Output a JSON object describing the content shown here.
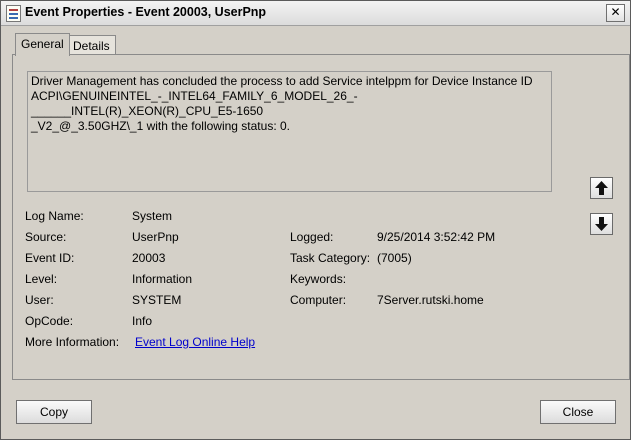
{
  "window": {
    "title": "Event Properties - Event 20003, UserPnp",
    "close_glyph": "✕"
  },
  "tabs": [
    {
      "label": "General"
    },
    {
      "label": "Details"
    }
  ],
  "description": "Driver Management has concluded the process to add Service intelppm for Device Instance ID\nACPI\\GENUINEINTEL_-_INTEL64_FAMILY_6_MODEL_26_-______INTEL(R)_XEON(R)_CPU_E5-1650\n_V2_@_3.50GHZ\\_1 with the following status: 0.",
  "fields": {
    "log_name": {
      "label": "Log Name:",
      "value": "System"
    },
    "source": {
      "label": "Source:",
      "value": "UserPnp"
    },
    "event_id": {
      "label": "Event ID:",
      "value": "20003"
    },
    "level": {
      "label": "Level:",
      "value": "Information"
    },
    "user": {
      "label": "User:",
      "value": "SYSTEM"
    },
    "opcode": {
      "label": "OpCode:",
      "value": "Info"
    },
    "more_info": {
      "label": "More Information:",
      "value": "Event Log Online Help"
    },
    "logged": {
      "label": "Logged:",
      "value": "9/25/2014 3:52:42 PM"
    },
    "task_category": {
      "label": "Task Category:",
      "value": "(7005)"
    },
    "keywords": {
      "label": "Keywords:",
      "value": ""
    },
    "computer": {
      "label": "Computer:",
      "value": "7Server.rutski.home"
    }
  },
  "nav": {
    "up_icon": "arrow-up-icon",
    "down_icon": "arrow-down-icon"
  },
  "buttons": {
    "copy": "Copy",
    "close": "Close"
  }
}
